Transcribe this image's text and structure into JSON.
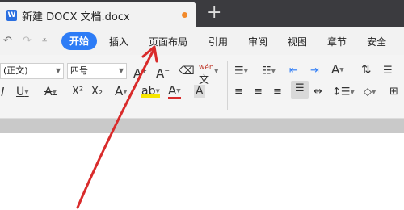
{
  "tab": {
    "app_icon": "W",
    "title": "新建 DOCX 文档.docx",
    "new_tab_label": "+"
  },
  "menu": {
    "items": [
      "开始",
      "插入",
      "页面布局",
      "引用",
      "审阅",
      "视图",
      "章节",
      "安全"
    ]
  },
  "ribbon": {
    "font_name": "(正文)",
    "font_size": "四号",
    "phonetic_label": "wén",
    "sup_label": "X²",
    "sub_label": "X₂"
  },
  "colors": {
    "tabbar": "#3b3b3f",
    "accent": "#2d7cf6",
    "annotation": "#d92b2b"
  }
}
